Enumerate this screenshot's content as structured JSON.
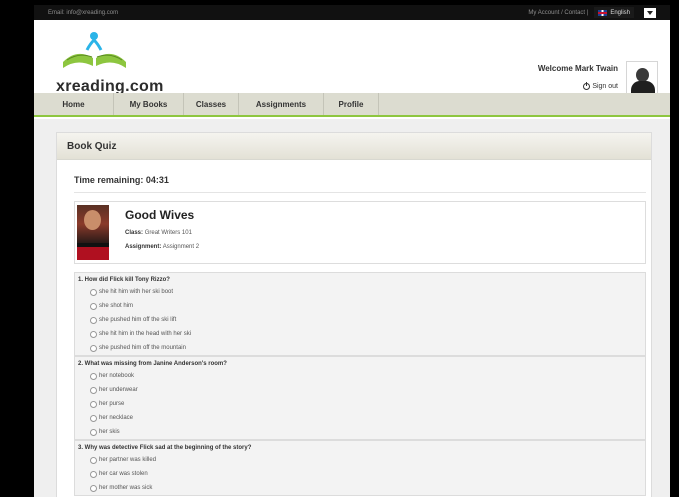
{
  "topbar": {
    "email": "Email: info@xreading.com",
    "links": "My Account / Contact |",
    "language": "English"
  },
  "header": {
    "logo_text": "xreading.com",
    "welcome": "Welcome Mark Twain",
    "sign_out": "Sign out"
  },
  "nav": {
    "items": [
      {
        "label": "Home"
      },
      {
        "label": "My Books"
      },
      {
        "label": "Classes"
      },
      {
        "label": "Assignments"
      },
      {
        "label": "Profile"
      }
    ]
  },
  "quiz": {
    "title": "Book Quiz",
    "time_remaining": "Time remaining: 04:31",
    "book": {
      "title": "Good Wives",
      "class_label": "Class:",
      "class_value": "Great Writers 101",
      "assignment_label": "Assignment:",
      "assignment_value": "Assignment 2"
    },
    "questions": [
      {
        "text": "1. How did Flick kill Tony Rizzo?",
        "options": [
          "she hit him with her ski boot",
          "she shot him",
          "she pushed him off the ski lift",
          "she hit him in the head with her ski",
          "she pushed him off the mountain"
        ]
      },
      {
        "text": "2. What was missing from Janine Anderson's room?",
        "options": [
          "her notebook",
          "her underwear",
          "her purse",
          "her necklace",
          "her skis"
        ]
      },
      {
        "text": "3. Why was detective Flick sad at the beginning of the story?",
        "options": [
          "her partner was killed",
          "her car was stolen",
          "her mother was sick"
        ]
      }
    ]
  }
}
